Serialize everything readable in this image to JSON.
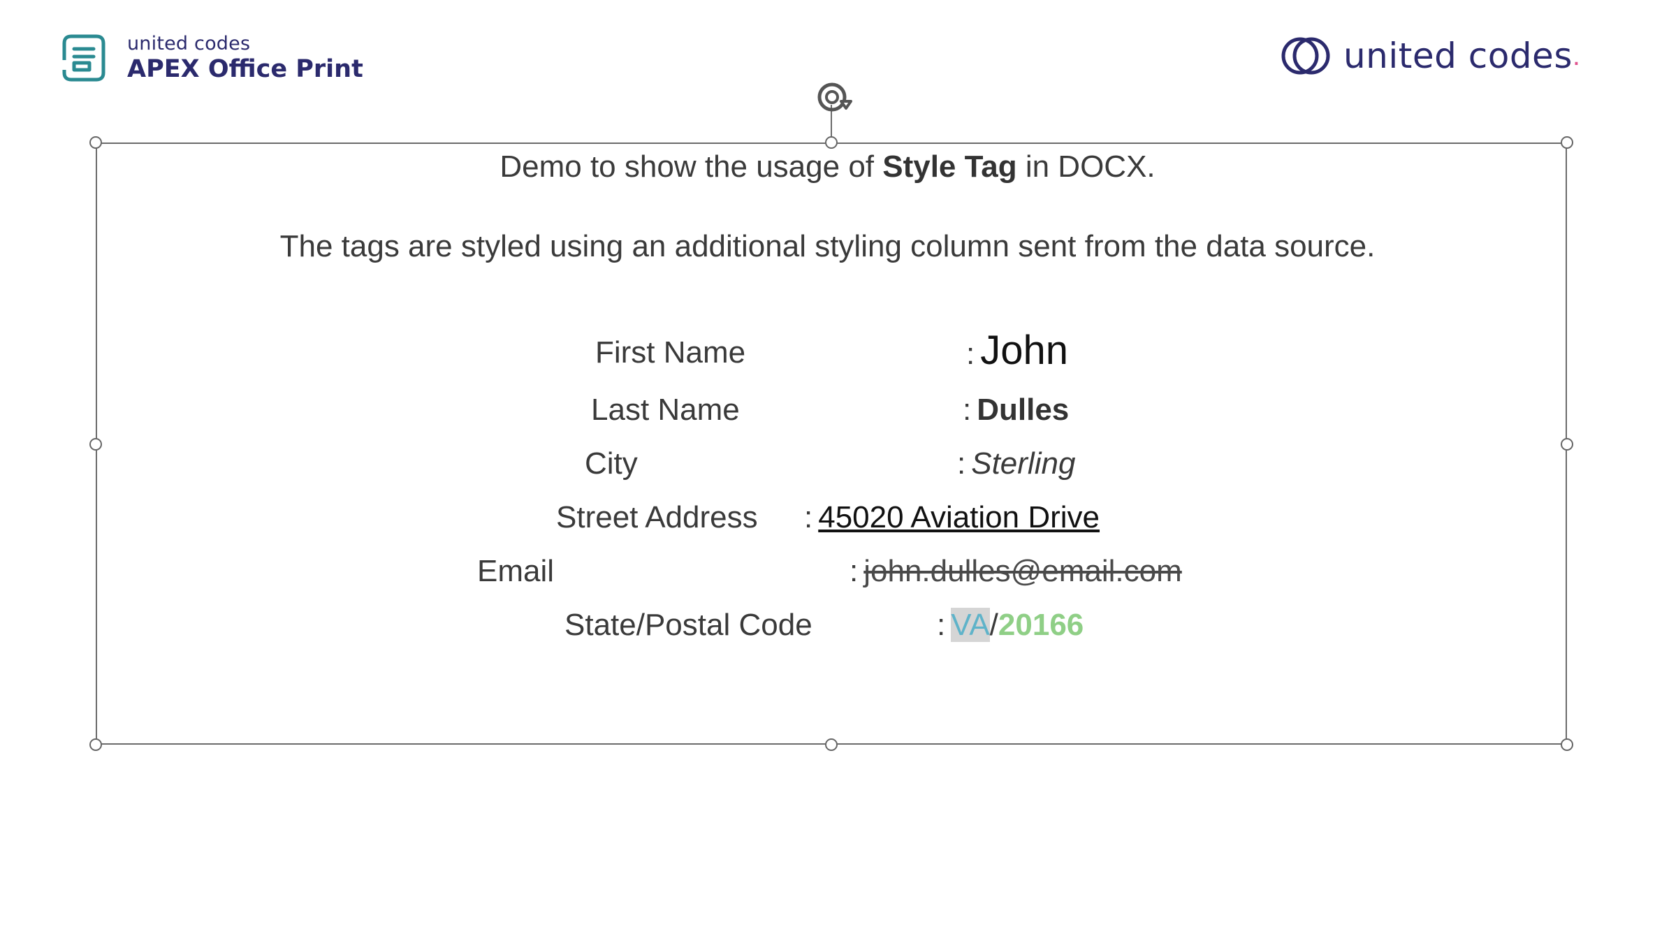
{
  "header": {
    "company": "united codes",
    "product": "APEX Office Print",
    "brand_logo_text": "united codes",
    "brand_dot": ".",
    "brand_color": "#2b2a6d",
    "brand_accent_color": "#e0528d",
    "logo_mark_color": "#2a8a91"
  },
  "document": {
    "heading_pre": "Demo to show the usage of ",
    "heading_bold": "Style Tag",
    "heading_post": " in DOCX.",
    "subheading": "The tags are styled using an additional styling column sent from the data source."
  },
  "fields": {
    "first_name": {
      "label": "First Name",
      "colon": ":",
      "value": "John"
    },
    "last_name": {
      "label": "Last Name",
      "colon": ":",
      "value": "Dulles"
    },
    "city": {
      "label": "City",
      "colon": ":",
      "value": "Sterling"
    },
    "street": {
      "label": "Street Address",
      "colon": ":",
      "value": "45020 Aviation Drive"
    },
    "email": {
      "label": "Email",
      "colon": ":",
      "value": "john.dulles@email.com"
    },
    "state_postal": {
      "label": "State/Postal Code",
      "colon": ":",
      "state": "VA",
      "separator": "/",
      "postal": "20166"
    }
  },
  "styles": {
    "state_color": "#5fb3c9",
    "state_highlight": "#d5d5d5",
    "postal_color": "#8fcf86"
  },
  "icons": {
    "aop_logo": "document-lines-icon",
    "uc_logo": "interlocking-rings-icon",
    "rotate": "rotate-handle-icon",
    "resize": "resize-handle-icon"
  }
}
